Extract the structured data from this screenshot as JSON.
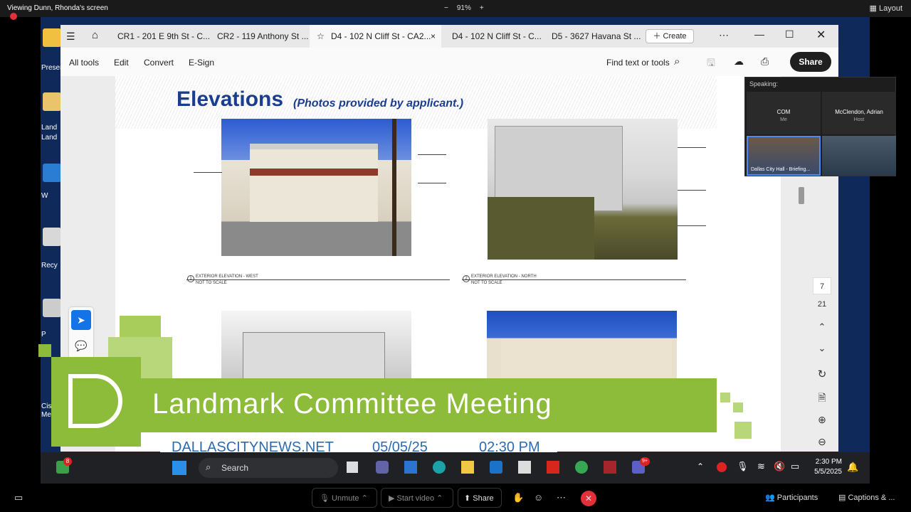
{
  "zoom": {
    "viewing_label": "Viewing Dunn, Rhonda's screen",
    "zoom_level": "91%",
    "zoom_minus": "−",
    "zoom_plus": "+",
    "layout_label": "Layout"
  },
  "desktop_icons": [
    {
      "label": "Presen"
    },
    {
      "label": "Land"
    },
    {
      "label": "Land"
    },
    {
      "label": "W"
    },
    {
      "label": "Recy"
    },
    {
      "label": "P"
    },
    {
      "label": "Cisc"
    },
    {
      "label": "Me"
    }
  ],
  "acrobat": {
    "tabs": [
      {
        "label": "CR1 - 201 E 9th St - C..."
      },
      {
        "label": "CR2 - 119 Anthony St ..."
      },
      {
        "label": "D4 - 102 N Cliff St - CA2..."
      },
      {
        "label": "D4 - 102 N Cliff St - C..."
      },
      {
        "label": "D5 - 3627 Havana St ..."
      }
    ],
    "create_label": "Create",
    "menu": {
      "all_tools": "All tools",
      "edit": "Edit",
      "convert": "Convert",
      "esign": "E-Sign",
      "find": "Find text or tools",
      "share": "Share"
    },
    "page_number": "7",
    "page_count": "21"
  },
  "pdf": {
    "title": "Elevations",
    "subtitle": "(Photos provided by applicant.)",
    "caption_west": "EXTERIOR ELEVATION - WEST",
    "caption_west_scale": "NOT TO SCALE",
    "caption_north": "EXTERIOR ELEVATION - NORTH",
    "caption_north_scale": "NOT TO SCALE",
    "west_number": "1",
    "north_number": "2"
  },
  "gallery": {
    "speaking_label": "Speaking:",
    "participants": [
      {
        "name": "COM",
        "sub": "Me"
      },
      {
        "name": "McClendon, Adrian",
        "sub": "Host"
      }
    ],
    "thumbs": [
      {
        "label": "Dallas City Hall - Briefing..."
      }
    ]
  },
  "broadcast": {
    "title": "Landmark Committee Meeting",
    "site": "DALLASCITYNEWS.NET",
    "date": "05/05/25",
    "time": "02:30 PM"
  },
  "taskbar": {
    "search_label": "Search",
    "badge_count": "8",
    "teams_badge": "9+",
    "clock_time": "2:30 PM",
    "clock_date": "5/5/2025"
  },
  "zoom_toolbar": {
    "unmute": "Unmute",
    "start_video": "Start video",
    "share": "Share",
    "participants": "Participants",
    "captions": "Captions & ..."
  },
  "colors": {
    "banner_green": "#8dbb3a",
    "acrobat_share": "#1f1f1f",
    "title_blue": "#1a3d8f",
    "site_blue": "#2c6bb3",
    "end_red": "#e0313a"
  }
}
